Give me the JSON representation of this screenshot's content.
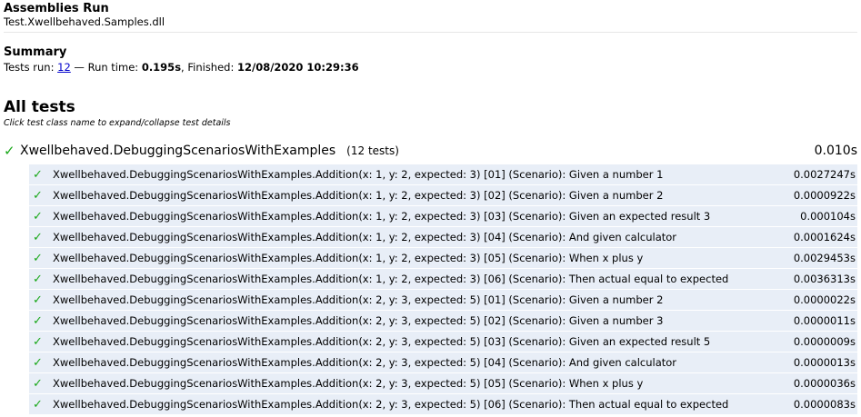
{
  "assemblies": {
    "title": "Assemblies Run",
    "dll": "Test.Xwellbehaved.Samples.dll"
  },
  "summary": {
    "title": "Summary",
    "tests_run_label": "Tests run: ",
    "tests_run_count": "12",
    "run_time_label": " — Run time: ",
    "run_time_value": "0.195s",
    "finished_label": ", Finished: ",
    "finished_value": "12/08/2020 10:29:36"
  },
  "all_tests": {
    "title": "All tests",
    "hint": "Click test class name to expand/collapse test details"
  },
  "test_class": {
    "status_icon": "checkmark-icon",
    "name": "Xwellbehaved.DebuggingScenariosWithExamples",
    "count": "(12 tests)",
    "time": "0.010s"
  },
  "tests": [
    {
      "name": "Xwellbehaved.DebuggingScenariosWithExamples.Addition(x: 1, y: 2, expected: 3) [01] (Scenario): Given a number 1",
      "time": "0.0027247s"
    },
    {
      "name": "Xwellbehaved.DebuggingScenariosWithExamples.Addition(x: 1, y: 2, expected: 3) [02] (Scenario): Given a number 2",
      "time": "0.0000922s"
    },
    {
      "name": "Xwellbehaved.DebuggingScenariosWithExamples.Addition(x: 1, y: 2, expected: 3) [03] (Scenario): Given an expected result 3",
      "time": "0.000104s"
    },
    {
      "name": "Xwellbehaved.DebuggingScenariosWithExamples.Addition(x: 1, y: 2, expected: 3) [04] (Scenario): And given calculator",
      "time": "0.0001624s"
    },
    {
      "name": "Xwellbehaved.DebuggingScenariosWithExamples.Addition(x: 1, y: 2, expected: 3) [05] (Scenario): When x plus y",
      "time": "0.0029453s"
    },
    {
      "name": "Xwellbehaved.DebuggingScenariosWithExamples.Addition(x: 1, y: 2, expected: 3) [06] (Scenario): Then actual equal to expected",
      "time": "0.0036313s"
    },
    {
      "name": "Xwellbehaved.DebuggingScenariosWithExamples.Addition(x: 2, y: 3, expected: 5) [01] (Scenario): Given a number 2",
      "time": "0.0000022s"
    },
    {
      "name": "Xwellbehaved.DebuggingScenariosWithExamples.Addition(x: 2, y: 3, expected: 5) [02] (Scenario): Given a number 3",
      "time": "0.0000011s"
    },
    {
      "name": "Xwellbehaved.DebuggingScenariosWithExamples.Addition(x: 2, y: 3, expected: 5) [03] (Scenario): Given an expected result 5",
      "time": "0.0000009s"
    },
    {
      "name": "Xwellbehaved.DebuggingScenariosWithExamples.Addition(x: 2, y: 3, expected: 5) [04] (Scenario): And given calculator",
      "time": "0.0000013s"
    },
    {
      "name": "Xwellbehaved.DebuggingScenariosWithExamples.Addition(x: 2, y: 3, expected: 5) [05] (Scenario): When x plus y",
      "time": "0.0000036s"
    },
    {
      "name": "Xwellbehaved.DebuggingScenariosWithExamples.Addition(x: 2, y: 3, expected: 5) [06] (Scenario): Then actual equal to expected",
      "time": "0.0000083s"
    }
  ],
  "colors": {
    "pass": "#1aa81a",
    "row_bg": "#e8eef7",
    "link": "#0000cc"
  }
}
